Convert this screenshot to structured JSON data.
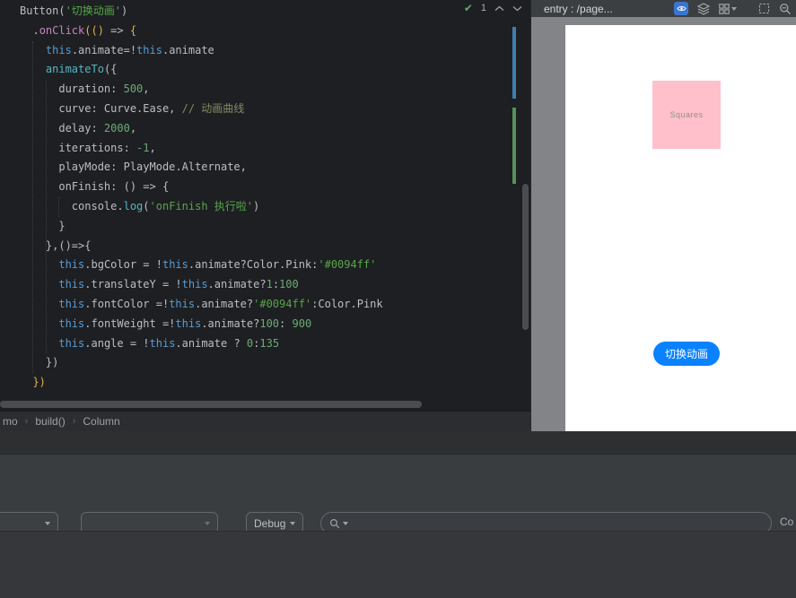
{
  "editor": {
    "inspection_count": "1",
    "inspections_icon": "✔",
    "token_colors": {
      "plain": "#BCBEC4",
      "method": "#C586C0",
      "func": "#56B6C2",
      "string": "#57A64A",
      "number": "#6AAB73",
      "comment": "#7F8C63",
      "this": "#569CD6",
      "bracket": "#E0B050"
    },
    "lines": [
      [
        {
          "t": "Button(",
          "c": "plain"
        },
        {
          "t": "'切换动画'",
          "c": "string"
        },
        {
          "t": ")",
          "c": "plain"
        }
      ],
      [
        {
          "t": "  .",
          "c": "plain"
        },
        {
          "t": "onClick",
          "c": "method"
        },
        {
          "t": "(()",
          "c": "bracket"
        },
        {
          "t": " => ",
          "c": "plain"
        },
        {
          "t": "{",
          "c": "bracket"
        }
      ],
      [
        {
          "t": "    ",
          "c": "plain"
        },
        {
          "t": "this",
          "c": "this"
        },
        {
          "t": ".animate=!",
          "c": "plain"
        },
        {
          "t": "this",
          "c": "this"
        },
        {
          "t": ".animate",
          "c": "plain"
        }
      ],
      [
        {
          "t": "    ",
          "c": "plain"
        },
        {
          "t": "animateTo",
          "c": "func"
        },
        {
          "t": "({",
          "c": "plain"
        }
      ],
      [
        {
          "t": "      duration: ",
          "c": "plain"
        },
        {
          "t": "500",
          "c": "number"
        },
        {
          "t": ",",
          "c": "plain"
        }
      ],
      [
        {
          "t": "      curve: Curve.Ease, ",
          "c": "plain"
        },
        {
          "t": "// 动画曲线",
          "c": "comment"
        }
      ],
      [
        {
          "t": "      delay: ",
          "c": "plain"
        },
        {
          "t": "2000",
          "c": "number"
        },
        {
          "t": ",",
          "c": "plain"
        }
      ],
      [
        {
          "t": "      iterations: ",
          "c": "plain"
        },
        {
          "t": "-1",
          "c": "number"
        },
        {
          "t": ",",
          "c": "plain"
        }
      ],
      [
        {
          "t": "      playMode: PlayMode.Alternate,",
          "c": "plain"
        }
      ],
      [
        {
          "t": "      onFinish: () => {",
          "c": "plain"
        }
      ],
      [
        {
          "t": "        console.",
          "c": "plain"
        },
        {
          "t": "log",
          "c": "func"
        },
        {
          "t": "(",
          "c": "plain"
        },
        {
          "t": "'onFinish 执行啦'",
          "c": "string"
        },
        {
          "t": ")",
          "c": "plain"
        }
      ],
      [
        {
          "t": "      }",
          "c": "plain"
        }
      ],
      [
        {
          "t": "    },()=>{",
          "c": "plain"
        }
      ],
      [
        {
          "t": "      ",
          "c": "plain"
        },
        {
          "t": "this",
          "c": "this"
        },
        {
          "t": ".bgColor = !",
          "c": "plain"
        },
        {
          "t": "this",
          "c": "this"
        },
        {
          "t": ".animate?Color.Pink:",
          "c": "plain"
        },
        {
          "t": "'#0094ff'",
          "c": "string"
        }
      ],
      [
        {
          "t": "      ",
          "c": "plain"
        },
        {
          "t": "this",
          "c": "this"
        },
        {
          "t": ".translateY = !",
          "c": "plain"
        },
        {
          "t": "this",
          "c": "this"
        },
        {
          "t": ".animate?",
          "c": "plain"
        },
        {
          "t": "1",
          "c": "number"
        },
        {
          "t": ":",
          "c": "plain"
        },
        {
          "t": "100",
          "c": "number"
        }
      ],
      [
        {
          "t": "      ",
          "c": "plain"
        },
        {
          "t": "this",
          "c": "this"
        },
        {
          "t": ".fontColor =!",
          "c": "plain"
        },
        {
          "t": "this",
          "c": "this"
        },
        {
          "t": ".animate?",
          "c": "plain"
        },
        {
          "t": "'#0094ff'",
          "c": "string"
        },
        {
          "t": ":Color.Pink",
          "c": "plain"
        }
      ],
      [
        {
          "t": "      ",
          "c": "plain"
        },
        {
          "t": "this",
          "c": "this"
        },
        {
          "t": ".fontWeight =!",
          "c": "plain"
        },
        {
          "t": "this",
          "c": "this"
        },
        {
          "t": ".animate?",
          "c": "plain"
        },
        {
          "t": "100",
          "c": "number"
        },
        {
          "t": ": ",
          "c": "plain"
        },
        {
          "t": "900",
          "c": "number"
        }
      ],
      [
        {
          "t": "      ",
          "c": "plain"
        },
        {
          "t": "this",
          "c": "this"
        },
        {
          "t": ".angle = !",
          "c": "plain"
        },
        {
          "t": "this",
          "c": "this"
        },
        {
          "t": ".animate ? ",
          "c": "plain"
        },
        {
          "t": "0",
          "c": "number"
        },
        {
          "t": ":",
          "c": "plain"
        },
        {
          "t": "135",
          "c": "number"
        }
      ],
      [
        {
          "t": "    })",
          "c": "plain"
        }
      ],
      [
        {
          "t": "  ",
          "c": "plain"
        },
        {
          "t": "})",
          "c": "bracket"
        }
      ]
    ]
  },
  "breadcrumb": {
    "items": [
      "mo",
      "build()",
      "Column"
    ],
    "separator": "›"
  },
  "preview": {
    "title": "entry : /page...",
    "header_icons": [
      "inspect-eye",
      "layers",
      "components-grid",
      "frame",
      "zoom-out"
    ],
    "square_text": "Squares",
    "square_color": "#FFC0CB",
    "button_label": "切换动画",
    "button_color": "#0A82FF"
  },
  "bottom_bar": {
    "combo1_value": "",
    "combo2_value": "",
    "debug_label": "Debug",
    "search_value": "",
    "search_icon": "magnifier",
    "right_text": "Co"
  }
}
